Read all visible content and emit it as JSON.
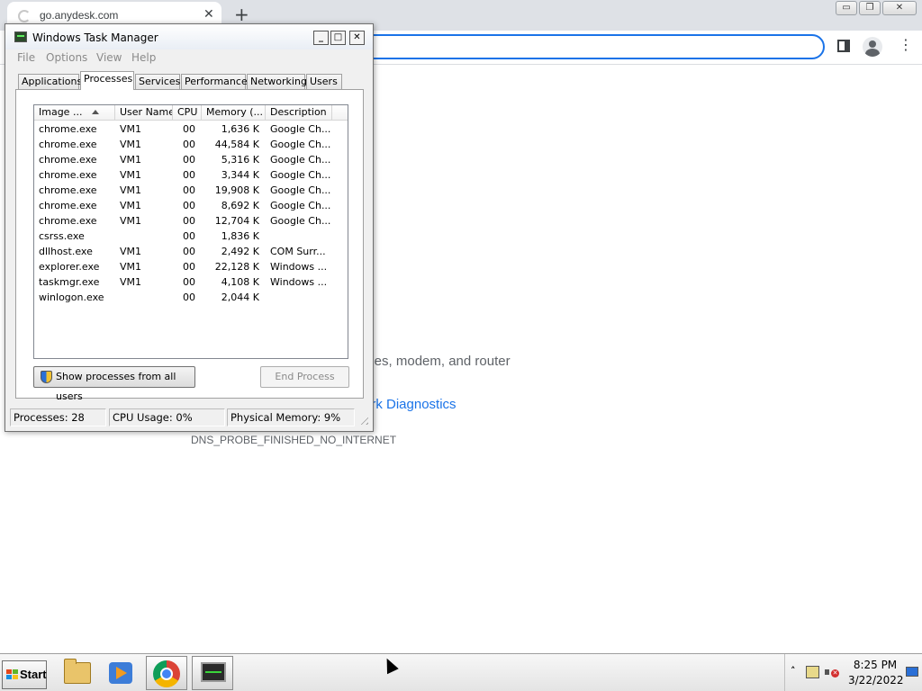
{
  "browser": {
    "tab_title": "go.anydesk.com",
    "tab_close_glyph": "✕",
    "new_tab_glyph": "+",
    "window_controls": {
      "minimize": "▭",
      "restore": "❐",
      "close": "✕"
    },
    "menu_glyph": "⋮",
    "error_text": "bles, modem, and router",
    "diagnostics_link": "ork Diagnostics",
    "error_code": "DNS_PROBE_FINISHED_NO_INTERNET",
    "accent_color": "#1a73e8"
  },
  "taskmgr": {
    "title": "Windows Task Manager",
    "controls": {
      "minimize": "_",
      "maximize": "□",
      "close": "✕"
    },
    "menu": {
      "file": "File",
      "options": "Options",
      "view": "View",
      "help": "Help"
    },
    "tabs": {
      "applications": "Applications",
      "processes": "Processes",
      "services": "Services",
      "performance": "Performance",
      "networking": "Networking",
      "users": "Users"
    },
    "active_tab": "Processes",
    "columns": {
      "image": "Image ...",
      "user": "User Name",
      "cpu": "CPU",
      "memory": "Memory (...",
      "description": "Description"
    },
    "processes": [
      {
        "image": "chrome.exe",
        "user": "VM1",
        "cpu": "00",
        "memory": "1,636 K",
        "description": "Google Ch..."
      },
      {
        "image": "chrome.exe",
        "user": "VM1",
        "cpu": "00",
        "memory": "44,584 K",
        "description": "Google Ch..."
      },
      {
        "image": "chrome.exe",
        "user": "VM1",
        "cpu": "00",
        "memory": "5,316 K",
        "description": "Google Ch..."
      },
      {
        "image": "chrome.exe",
        "user": "VM1",
        "cpu": "00",
        "memory": "3,344 K",
        "description": "Google Ch..."
      },
      {
        "image": "chrome.exe",
        "user": "VM1",
        "cpu": "00",
        "memory": "19,908 K",
        "description": "Google Ch..."
      },
      {
        "image": "chrome.exe",
        "user": "VM1",
        "cpu": "00",
        "memory": "8,692 K",
        "description": "Google Ch..."
      },
      {
        "image": "chrome.exe",
        "user": "VM1",
        "cpu": "00",
        "memory": "12,704 K",
        "description": "Google Ch..."
      },
      {
        "image": "csrss.exe",
        "user": "",
        "cpu": "00",
        "memory": "1,836 K",
        "description": ""
      },
      {
        "image": "dllhost.exe",
        "user": "VM1",
        "cpu": "00",
        "memory": "2,492 K",
        "description": "COM Surr..."
      },
      {
        "image": "explorer.exe",
        "user": "VM1",
        "cpu": "00",
        "memory": "22,128 K",
        "description": "Windows ..."
      },
      {
        "image": "taskmgr.exe",
        "user": "VM1",
        "cpu": "00",
        "memory": "4,108 K",
        "description": "Windows ..."
      },
      {
        "image": "winlogon.exe",
        "user": "",
        "cpu": "00",
        "memory": "2,044 K",
        "description": ""
      }
    ],
    "show_all_label": "Show processes from all users",
    "end_process_label": "End Process",
    "status": {
      "processes": "Processes: 28",
      "cpu": "CPU Usage: 0%",
      "memory": "Physical Memory: 9%"
    }
  },
  "taskbar": {
    "start_label": "Start",
    "tray_expand_glyph": "˄",
    "clock_time": "8:25 PM",
    "clock_date": "3/22/2022",
    "pinned": [
      "windows-explorer-icon",
      "media-player-icon",
      "chrome-icon",
      "task-manager-icon"
    ]
  }
}
